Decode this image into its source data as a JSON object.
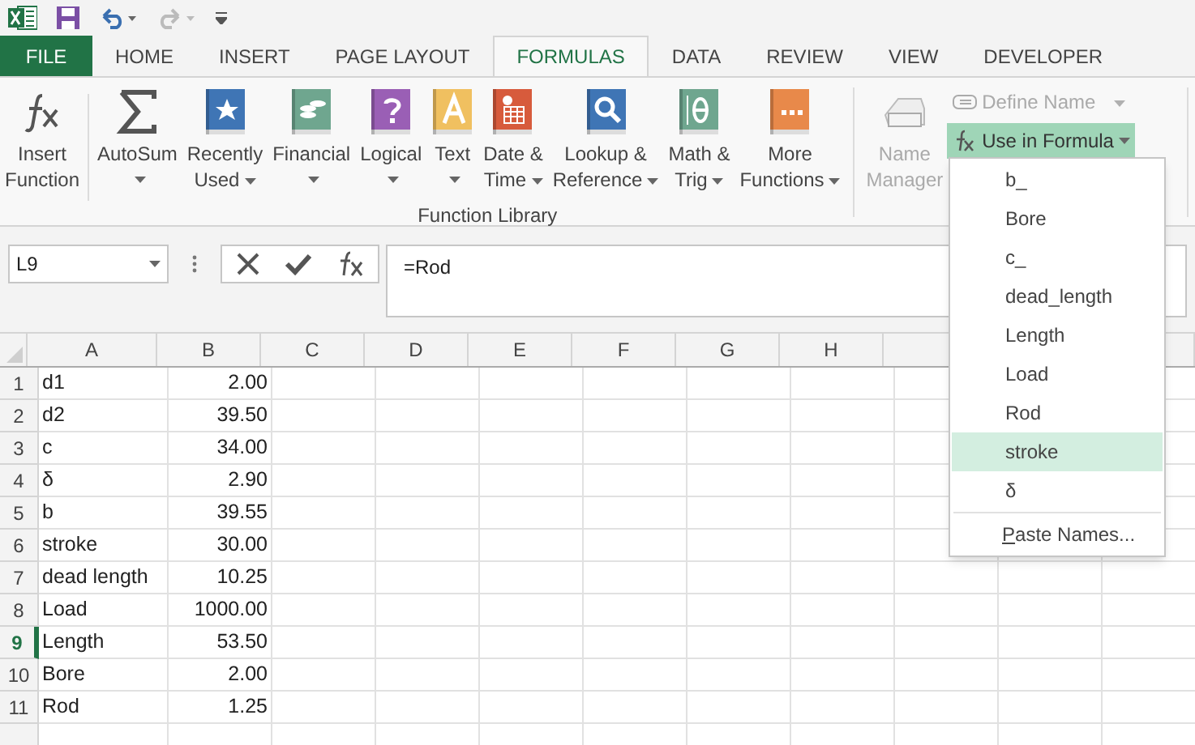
{
  "tabs": [
    {
      "label": "FILE",
      "kind": "file",
      "selected": false
    },
    {
      "label": "HOME",
      "kind": "tab",
      "selected": false
    },
    {
      "label": "INSERT",
      "kind": "tab",
      "selected": false
    },
    {
      "label": "PAGE LAYOUT",
      "kind": "tab",
      "selected": false
    },
    {
      "label": "FORMULAS",
      "kind": "tab",
      "selected": true
    },
    {
      "label": "DATA",
      "kind": "tab",
      "selected": false
    },
    {
      "label": "REVIEW",
      "kind": "tab",
      "selected": false
    },
    {
      "label": "VIEW",
      "kind": "tab",
      "selected": false
    },
    {
      "label": "DEVELOPER",
      "kind": "tab",
      "selected": false
    }
  ],
  "function_library": {
    "label": "Function Library",
    "buttons": [
      {
        "kind": "fx",
        "lines": [
          "Insert",
          "Function"
        ],
        "menu": false
      },
      {
        "kind": "sigma",
        "lines": [
          "AutoSum"
        ],
        "menu": true
      },
      {
        "kind": "star",
        "lines": [
          "Recently",
          "Used"
        ],
        "menu": true
      },
      {
        "kind": "coins",
        "lines": [
          "Financial"
        ],
        "menu": true
      },
      {
        "kind": "question",
        "lines": [
          "Logical"
        ],
        "menu": true
      },
      {
        "kind": "letter",
        "lines": [
          "Text"
        ],
        "menu": true
      },
      {
        "kind": "calendar",
        "lines": [
          "Date &",
          "Time"
        ],
        "menu": true
      },
      {
        "kind": "magnifier",
        "lines": [
          "Lookup &",
          "Reference"
        ],
        "menu": true
      },
      {
        "kind": "theta",
        "lines": [
          "Math &",
          "Trig"
        ],
        "menu": true
      },
      {
        "kind": "dots",
        "lines": [
          "More",
          "Functions"
        ],
        "menu": true
      }
    ]
  },
  "defined_names": {
    "name_manager": {
      "lines": [
        "Name",
        "Manager"
      ],
      "disabled": true
    },
    "define_name": {
      "label": "Define Name",
      "disabled": true
    },
    "use_in_formula": {
      "label": "Use in Formula",
      "expanded": true
    }
  },
  "formula_bar": {
    "name_box": "L9",
    "formula": "=Rod"
  },
  "sheet": {
    "columns": [
      "A",
      "B",
      "C",
      "D",
      "E",
      "F",
      "G",
      "H"
    ],
    "rows": [
      {
        "number": "1",
        "a": "d1",
        "b": "2.00",
        "selected": false
      },
      {
        "number": "2",
        "a": "d2",
        "b": "39.50",
        "selected": false
      },
      {
        "number": "3",
        "a": "c",
        "b": "34.00",
        "selected": false
      },
      {
        "number": "4",
        "a": "δ",
        "b": "2.90",
        "selected": false
      },
      {
        "number": "5",
        "a": "b",
        "b": "39.55",
        "selected": false
      },
      {
        "number": "6",
        "a": "stroke",
        "b": "30.00",
        "selected": false
      },
      {
        "number": "7",
        "a": "dead length",
        "b": "10.25",
        "selected": false
      },
      {
        "number": "8",
        "a": "Load",
        "b": "1000.00",
        "selected": false
      },
      {
        "number": "9",
        "a": "Length",
        "b": "53.50",
        "selected": true
      },
      {
        "number": "10",
        "a": "Bore",
        "b": "2.00",
        "selected": false
      },
      {
        "number": "11",
        "a": "Rod",
        "b": "1.25",
        "selected": false
      }
    ]
  },
  "names_menu": {
    "items": [
      {
        "label": "b_",
        "selected": false
      },
      {
        "label": "Bore",
        "selected": false
      },
      {
        "label": "c_",
        "selected": false
      },
      {
        "label": "dead_length",
        "selected": false
      },
      {
        "label": "Length",
        "selected": false
      },
      {
        "label": "Load",
        "selected": false
      },
      {
        "label": "Rod",
        "selected": false
      },
      {
        "label": "stroke",
        "selected": true
      },
      {
        "label": "δ",
        "selected": false
      }
    ],
    "footer": "Paste Names..."
  }
}
